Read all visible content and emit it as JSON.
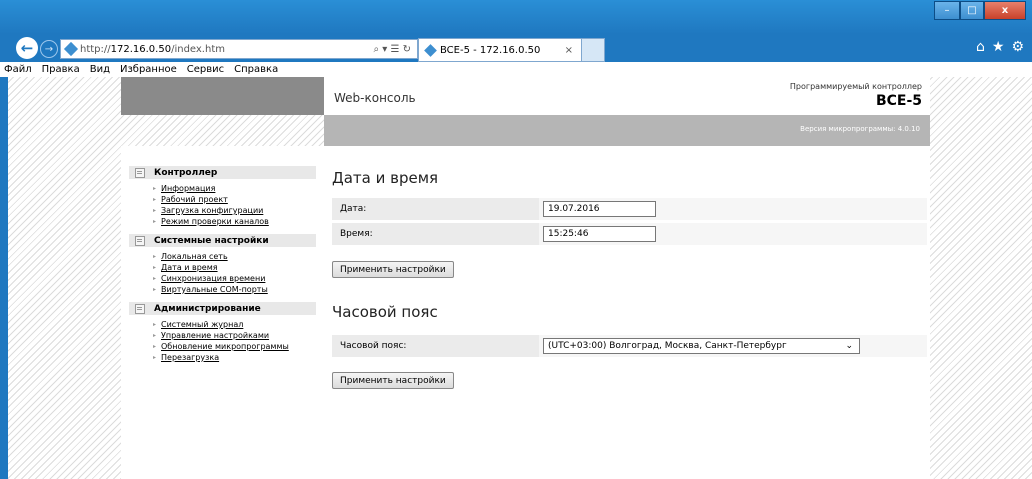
{
  "browser": {
    "address": {
      "prefix": "http://",
      "host": "172.16.0.50",
      "path": "/index.htm",
      "tools": "⌕ ▾ ☰ ↻"
    },
    "tab_title": "BCE-5 - 172.16.0.50",
    "tab_close": "×",
    "window_controls": {
      "minimize": "–",
      "maximize": "□",
      "close": "x"
    },
    "right_icons": [
      "⌂",
      "★",
      "⚙"
    ],
    "menu": [
      "Файл",
      "Правка",
      "Вид",
      "Избранное",
      "Сервис",
      "Справка"
    ]
  },
  "header": {
    "title": "Web-консоль",
    "model_label": "Программируемый контроллер",
    "model": "BCE-5",
    "firmware": "Версия микропрограммы: 4.0.10"
  },
  "sidebar": {
    "sections": [
      {
        "title": "Контроллер",
        "items": [
          "Информация",
          "Рабочий проект",
          "Загрузка конфигурации",
          "Режим проверки каналов"
        ]
      },
      {
        "title": "Системные настройки",
        "items": [
          "Локальная сеть",
          "Дата и время",
          "Синхронизация времени",
          "Виртуальные COM-порты"
        ]
      },
      {
        "title": "Администрирование",
        "items": [
          "Системный журнал",
          "Управление настройками",
          "Обновление микропрограммы",
          "Перезагрузка"
        ]
      }
    ]
  },
  "datetime": {
    "title": "Дата и время",
    "date_label": "Дата:",
    "date_value": "19.07.2016",
    "time_label": "Время:",
    "time_value": "15:25:46",
    "apply_label": "Применить настройки"
  },
  "timezone": {
    "title": "Часовой пояс",
    "label": "Часовой пояс:",
    "value": "(UTC+03:00) Волгоград, Москва, Санкт-Петербург",
    "apply_label": "Применить настройки"
  }
}
